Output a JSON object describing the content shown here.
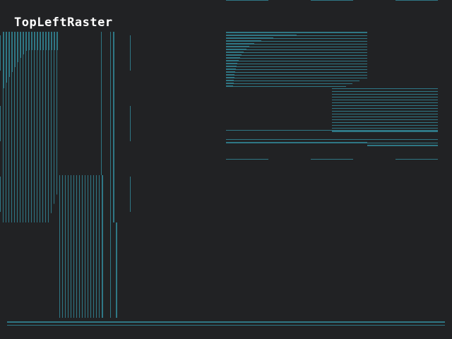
{
  "title": "TopLeftRaster",
  "colors": {
    "background": "#212224",
    "line": "#2f7785",
    "title": "#ffffff"
  }
}
